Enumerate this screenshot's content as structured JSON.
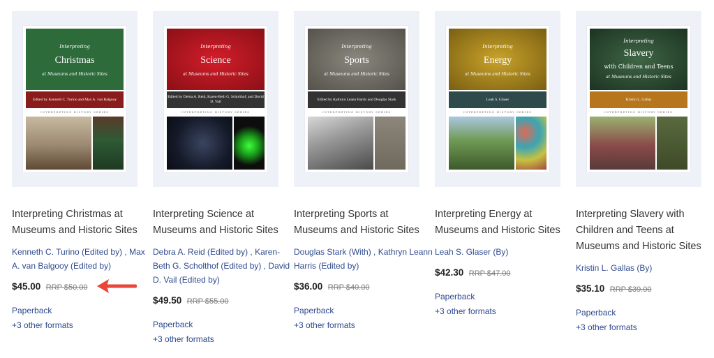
{
  "books": [
    {
      "cover": {
        "series_small": "Interpreting",
        "big": "Christmas",
        "sub": "at Museums and Historic Sites",
        "band": "Edited by Kenneth C. Turino and Max A. van Balgooy",
        "series": "INTERPRETING HISTORY SERIES"
      },
      "title": "Interpreting Christmas at Museums and Historic Sites",
      "authors": "Kenneth C. Turino (Edited by) , Max A. van Balgooy (Edited by)",
      "price": "$45.00",
      "rrp": "RRP $50.00",
      "format": "Paperback",
      "other_formats": "+3 other formats",
      "colors": {
        "top": "#2d6b3a",
        "band": "#8a1c1c",
        "ph1": "#9b8870",
        "ph2": "#3a4a3a"
      }
    },
    {
      "cover": {
        "series_small": "Interpreting",
        "big": "Science",
        "sub": "at Museums and Historic Sites",
        "band": "Edited by Debra A. Reid, Karen-Beth G. Scholthof, and David D. Vail",
        "series": "INTERPRETING HISTORY SERIES"
      },
      "title": "Interpreting Science at Museums and Historic Sites",
      "authors": "Debra A. Reid (Edited by) , Karen-Beth G. Scholthof (Edited by) , David D. Vail (Edited by)",
      "price": "$49.50",
      "rrp": "RRP $55.00",
      "format": "Paperback",
      "other_formats": "+3 other formats",
      "colors": {
        "top": "#b3161f",
        "band": "#333333",
        "ph1": "#1e2230",
        "ph2": "#111111"
      }
    },
    {
      "cover": {
        "series_small": "Interpreting",
        "big": "Sports",
        "sub": "at Museums and Historic Sites",
        "band": "Edited by Kathryn Leann Harris and Douglas Stark",
        "series": "INTERPRETING HISTORY SERIES"
      },
      "title": "Interpreting Sports at Museums and Historic Sites",
      "authors": "Douglas Stark (With) , Kathryn Leann Harris (Edited by)",
      "price": "$36.00",
      "rrp": "RRP $40.00",
      "format": "Paperback",
      "other_formats": "+3 other formats",
      "colors": {
        "top": "#6f6c64",
        "band": "#333333",
        "ph1": "#8a8a8a",
        "ph2": "#7d776c"
      }
    },
    {
      "cover": {
        "series_small": "Interpreting",
        "big": "Energy",
        "sub": "at Museums and Historic Sites",
        "band": "Leah S. Glaser",
        "series": "INTERPRETING HISTORY SERIES"
      },
      "title": "Interpreting Energy at Museums and Historic Sites",
      "authors": "Leah S. Glaser (By)",
      "price": "$42.30",
      "rrp": "RRP $47.00",
      "format": "Paperback",
      "other_formats": "+3 other formats",
      "colors": {
        "top": "#a8861f",
        "band": "#2f4a4a",
        "ph1": "#5f8a4a",
        "ph2": "#b06a5a"
      }
    },
    {
      "cover": {
        "series_small": "Interpreting",
        "big": "Slavery",
        "sub2": "with Children and Teens",
        "sub": "at Museums and Historic Sites",
        "band": "Kristin L. Gallas",
        "series": "INTERPRETING HISTORY SERIES"
      },
      "title": "Interpreting Slavery with Children and Teens at Museums and Historic Sites",
      "authors": "Kristin L. Gallas (By)",
      "price": "$35.10",
      "rrp": "RRP $39.00",
      "format": "Paperback",
      "other_formats": "+3 other formats",
      "colors": {
        "top": "#2e4b33",
        "band": "#b8761c",
        "ph1": "#7a8a6a",
        "ph2": "#4a5a35"
      }
    }
  ],
  "annotation": {
    "arrow_icon": "red-arrow-icon",
    "arrow_color": "#e8473a"
  }
}
